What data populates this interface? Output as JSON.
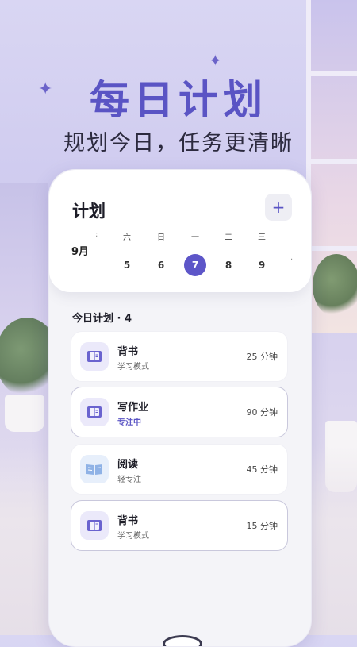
{
  "hero": {
    "title": "每日计划",
    "subtitle": "规划今日，任务更清晰"
  },
  "header": {
    "title": "计划",
    "add_label": "+"
  },
  "calendar": {
    "month": "9月",
    "days": [
      {
        "dow": "六",
        "num": "5",
        "active": false
      },
      {
        "dow": "日",
        "num": "6",
        "active": false
      },
      {
        "dow": "一",
        "num": "7",
        "active": true
      },
      {
        "dow": "二",
        "num": "8",
        "active": false
      },
      {
        "dow": "三",
        "num": "9",
        "active": false
      }
    ]
  },
  "today": {
    "label": "今日计划 · 4"
  },
  "tasks": [
    {
      "name": "背书",
      "mode": "学习模式",
      "duration": "25 分钟",
      "icon": "book-icon"
    },
    {
      "name": "写作业",
      "mode": "专注中",
      "duration": "90 分钟",
      "icon": "book-icon"
    },
    {
      "name": "阅读",
      "mode": "轻专注",
      "duration": "45 分钟",
      "icon": "open-book-icon"
    },
    {
      "name": "背书",
      "mode": "学习模式",
      "duration": "15 分钟",
      "icon": "book-icon"
    }
  ],
  "colors": {
    "accent": "#5d56c8",
    "title": "#5a54c4",
    "background": "#d9d6f3"
  }
}
